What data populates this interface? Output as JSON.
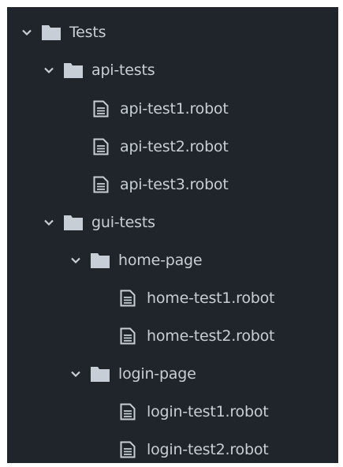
{
  "tree": {
    "root": {
      "label": "Tests",
      "api_tests": {
        "label": "api-tests",
        "files": [
          "api-test1.robot",
          "api-test2.robot",
          "api-test3.robot"
        ]
      },
      "gui_tests": {
        "label": "gui-tests",
        "home_page": {
          "label": "home-page",
          "files": [
            "home-test1.robot",
            "home-test2.robot"
          ]
        },
        "login_page": {
          "label": "login-page",
          "files": [
            "login-test1.robot",
            "login-test2.robot"
          ]
        }
      }
    }
  },
  "colors": {
    "background": "#20252b",
    "text": "#c8ced6",
    "icon": "#c8ced6"
  },
  "icons": {
    "expanded": "chevron-down-icon",
    "folder": "folder-icon",
    "file": "file-icon"
  }
}
